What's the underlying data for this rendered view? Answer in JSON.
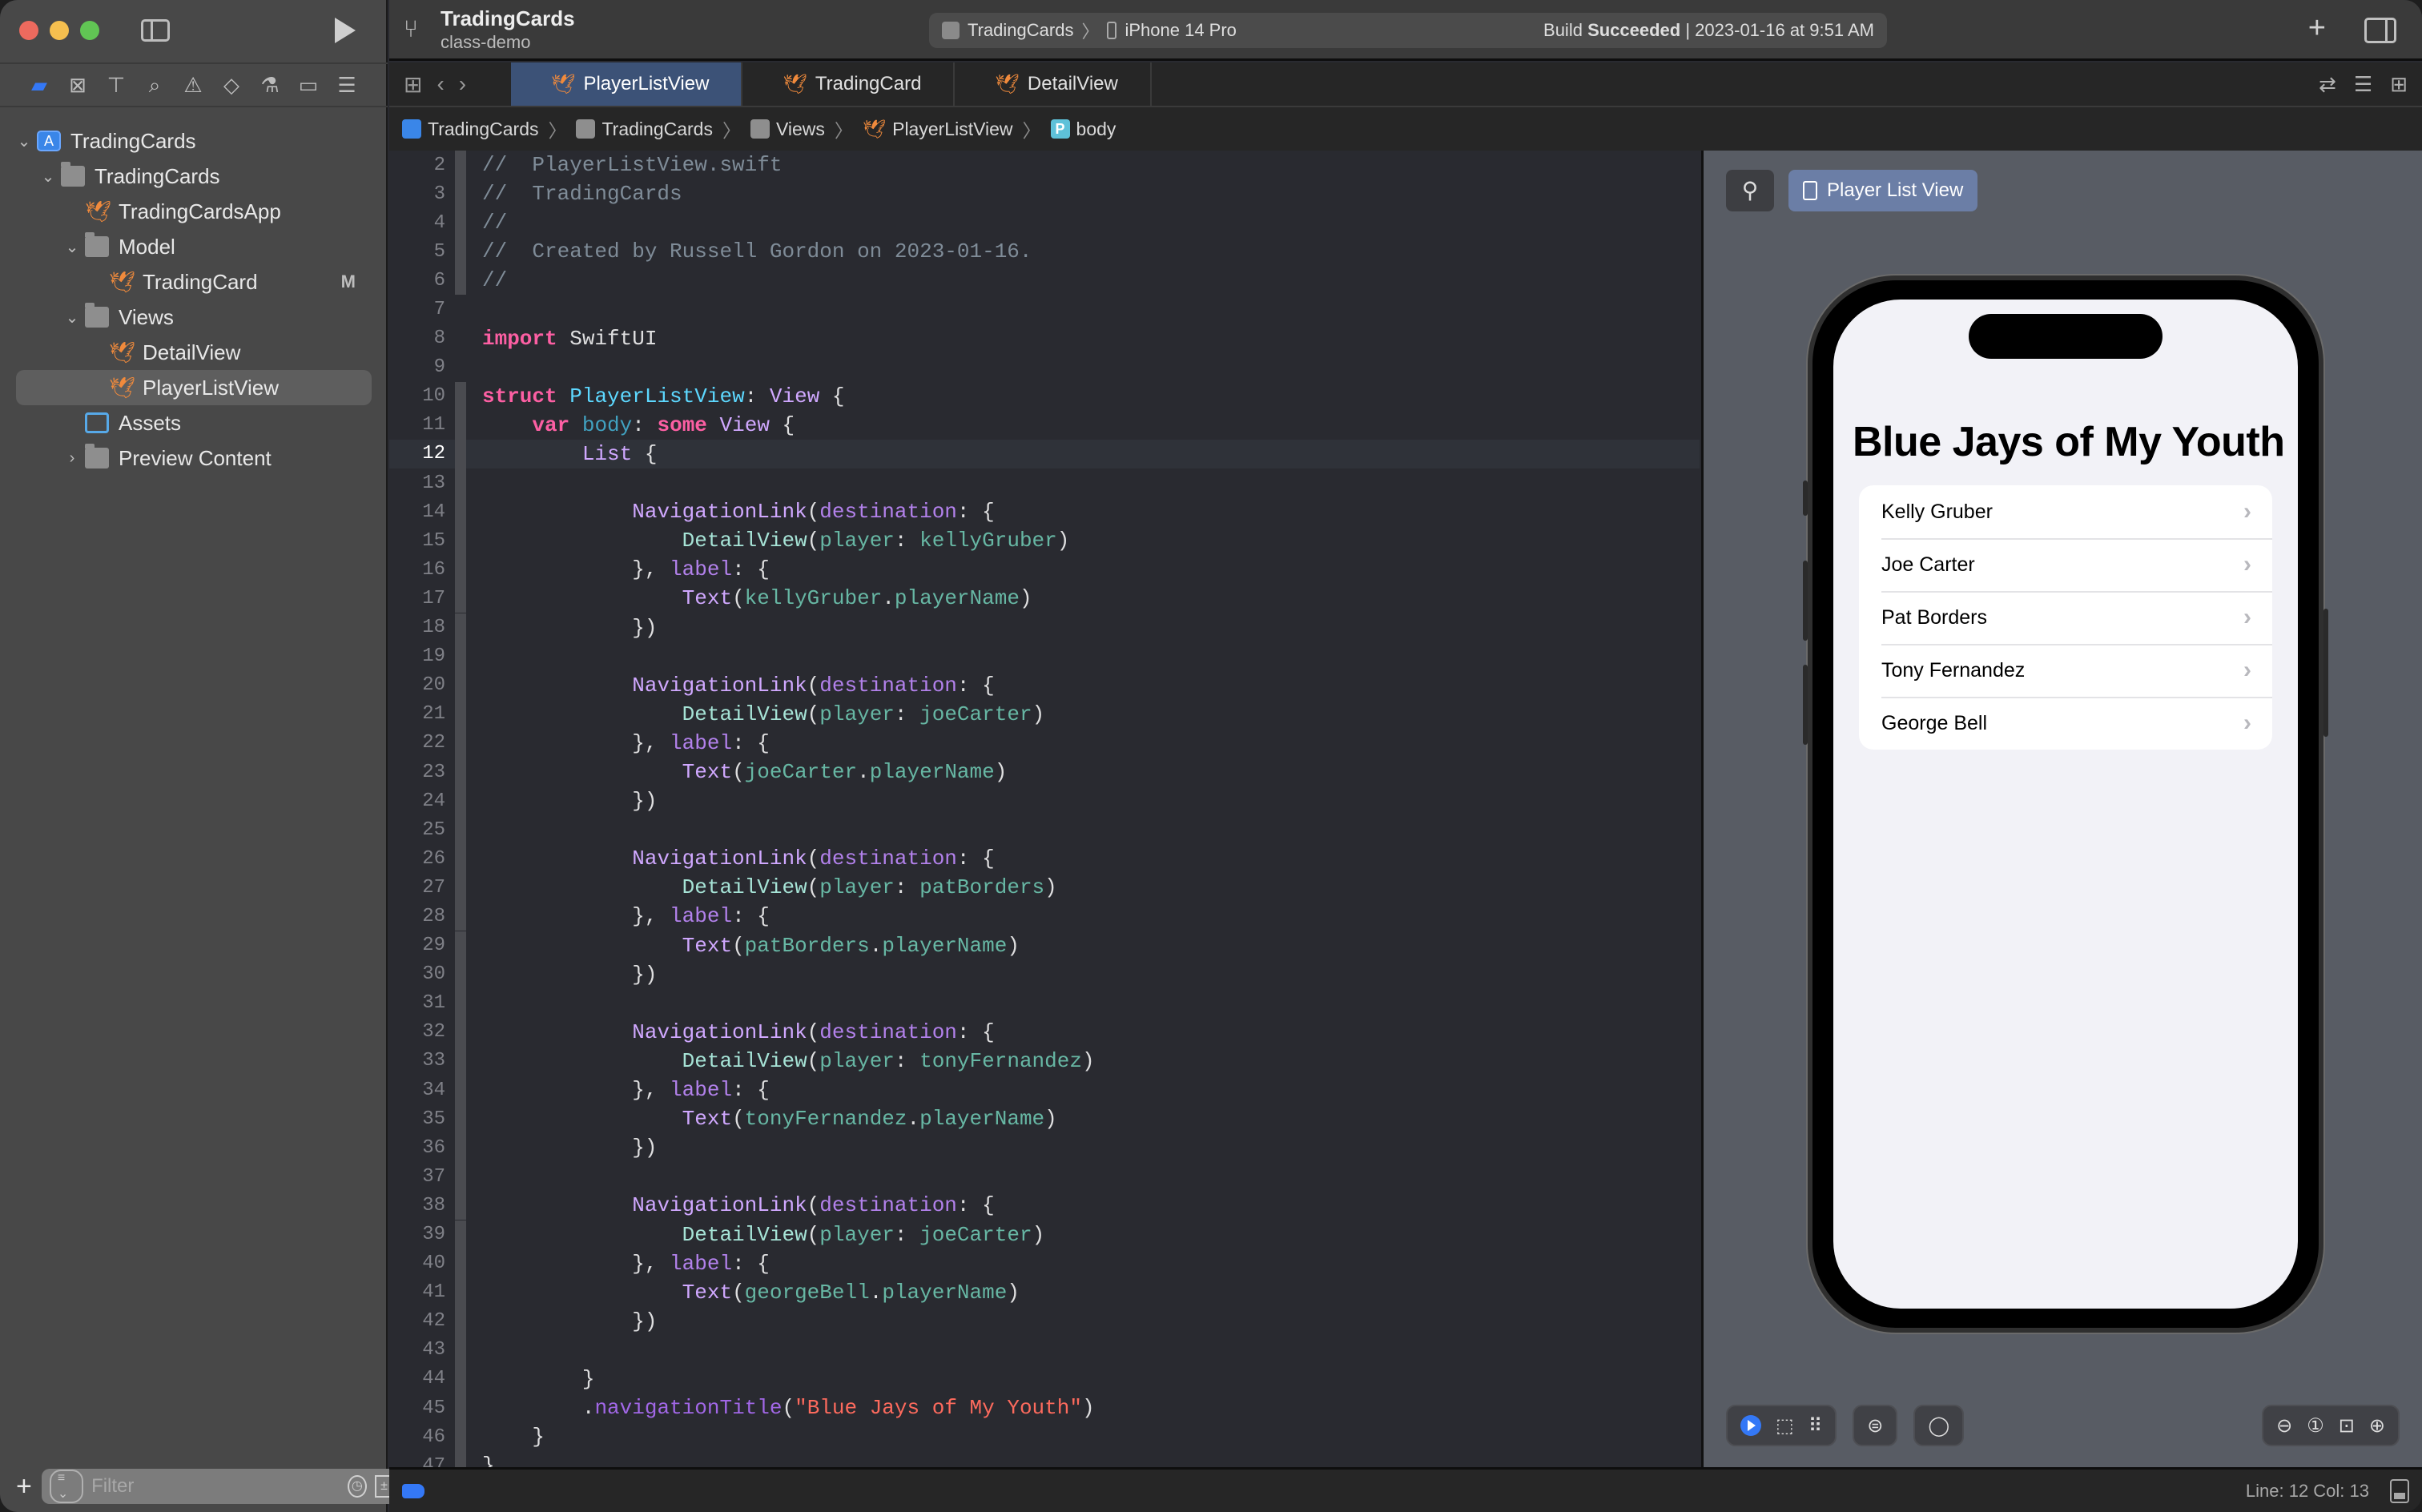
{
  "window": {
    "project_title": "TradingCards",
    "branch": "class-demo"
  },
  "toolbar": {
    "scheme_name": "TradingCards",
    "destination": "iPhone 14 Pro",
    "status_prefix": "Build",
    "status_bold": "Succeeded",
    "status_suffix": " | 2023-01-16 at 9:51 AM"
  },
  "navigator": {
    "tabs": [
      {
        "icon": "folder-icon",
        "glyph": "▰"
      },
      {
        "icon": "source-control-icon",
        "glyph": "⊠"
      },
      {
        "icon": "symbol-navigator-icon",
        "glyph": "⊤"
      },
      {
        "icon": "find-icon",
        "glyph": "⌕"
      },
      {
        "icon": "issue-icon",
        "glyph": "⚠"
      },
      {
        "icon": "test-icon",
        "glyph": "◇"
      },
      {
        "icon": "debug-icon",
        "glyph": "⚗"
      },
      {
        "icon": "breakpoint-icon",
        "glyph": "▭"
      },
      {
        "icon": "report-icon",
        "glyph": "☰"
      }
    ],
    "tree": [
      {
        "label": "TradingCards",
        "type": "project",
        "depth": 0,
        "expanded": true
      },
      {
        "label": "TradingCards",
        "type": "folder",
        "depth": 1,
        "expanded": true
      },
      {
        "label": "TradingCardsApp",
        "type": "swift",
        "depth": 2
      },
      {
        "label": "Model",
        "type": "folder",
        "depth": 2,
        "expanded": true
      },
      {
        "label": "TradingCard",
        "type": "swift",
        "depth": 3,
        "badge": "M"
      },
      {
        "label": "Views",
        "type": "folder",
        "depth": 2,
        "expanded": true
      },
      {
        "label": "DetailView",
        "type": "swift",
        "depth": 3
      },
      {
        "label": "PlayerListView",
        "type": "swift",
        "depth": 3,
        "selected": true
      },
      {
        "label": "Assets",
        "type": "assets",
        "depth": 2
      },
      {
        "label": "Preview Content",
        "type": "folder",
        "depth": 2,
        "expanded": false
      }
    ],
    "filter_placeholder": "Filter"
  },
  "tabs": [
    {
      "label": "PlayerListView",
      "active": true
    },
    {
      "label": "TradingCard",
      "active": false
    },
    {
      "label": "DetailView",
      "active": false
    }
  ],
  "breadcrumb": {
    "items": [
      "TradingCards",
      "TradingCards",
      "Views",
      "PlayerListView",
      "body"
    ]
  },
  "editor": {
    "current_line": 12,
    "lines": [
      {
        "n": 2,
        "t": [
          [
            "cm",
            "//  PlayerListView.swift"
          ]
        ]
      },
      {
        "n": 3,
        "t": [
          [
            "cm",
            "//  TradingCards"
          ]
        ]
      },
      {
        "n": 4,
        "t": [
          [
            "cm",
            "//"
          ]
        ]
      },
      {
        "n": 5,
        "t": [
          [
            "cm",
            "//  Created by Russell Gordon on 2023-01-16."
          ]
        ]
      },
      {
        "n": 6,
        "t": [
          [
            "cm",
            "//"
          ]
        ]
      },
      {
        "n": 7,
        "t": []
      },
      {
        "n": 8,
        "t": [
          [
            "kw",
            "import"
          ],
          [
            "pl",
            " SwiftUI"
          ]
        ]
      },
      {
        "n": 9,
        "t": []
      },
      {
        "n": 10,
        "t": [
          [
            "kw",
            "struct"
          ],
          [
            "pl",
            " "
          ],
          [
            "ty",
            "PlayerListView"
          ],
          [
            "pl",
            ": "
          ],
          [
            "tp",
            "View"
          ],
          [
            "pl",
            " {"
          ]
        ]
      },
      {
        "n": 11,
        "t": [
          [
            "pl",
            "    "
          ],
          [
            "kw",
            "var"
          ],
          [
            "pl",
            " "
          ],
          [
            "bl",
            "body"
          ],
          [
            "pl",
            ": "
          ],
          [
            "kw",
            "some"
          ],
          [
            "pl",
            " "
          ],
          [
            "tp",
            "View"
          ],
          [
            "pl",
            " {"
          ]
        ]
      },
      {
        "n": 12,
        "t": [
          [
            "pl",
            "        "
          ],
          [
            "tp",
            "List"
          ],
          [
            "pl",
            " {"
          ]
        ]
      },
      {
        "n": 13,
        "t": []
      },
      {
        "n": 14,
        "t": [
          [
            "pl",
            "            "
          ],
          [
            "tp",
            "NavigationLink"
          ],
          [
            "pl",
            "("
          ],
          [
            "at",
            "destination"
          ],
          [
            "pl",
            ": {"
          ]
        ]
      },
      {
        "n": 15,
        "t": [
          [
            "pl",
            "                "
          ],
          [
            "pr",
            "DetailView"
          ],
          [
            "pl",
            "("
          ],
          [
            "vr",
            "player"
          ],
          [
            "pl",
            ": "
          ],
          [
            "vr",
            "kellyGruber"
          ],
          [
            "pl",
            ")"
          ]
        ]
      },
      {
        "n": 16,
        "t": [
          [
            "pl",
            "            }, "
          ],
          [
            "at",
            "label"
          ],
          [
            "pl",
            ": {"
          ]
        ]
      },
      {
        "n": 17,
        "t": [
          [
            "pl",
            "                "
          ],
          [
            "tp",
            "Text"
          ],
          [
            "pl",
            "("
          ],
          [
            "vr",
            "kellyGruber"
          ],
          [
            "pl",
            "."
          ],
          [
            "vr",
            "playerName"
          ],
          [
            "pl",
            ")"
          ]
        ]
      },
      {
        "n": 18,
        "t": [
          [
            "pl",
            "            })"
          ]
        ]
      },
      {
        "n": 19,
        "t": []
      },
      {
        "n": 20,
        "t": [
          [
            "pl",
            "            "
          ],
          [
            "tp",
            "NavigationLink"
          ],
          [
            "pl",
            "("
          ],
          [
            "at",
            "destination"
          ],
          [
            "pl",
            ": {"
          ]
        ]
      },
      {
        "n": 21,
        "t": [
          [
            "pl",
            "                "
          ],
          [
            "pr",
            "DetailView"
          ],
          [
            "pl",
            "("
          ],
          [
            "vr",
            "player"
          ],
          [
            "pl",
            ": "
          ],
          [
            "vr",
            "joeCarter"
          ],
          [
            "pl",
            ")"
          ]
        ]
      },
      {
        "n": 22,
        "t": [
          [
            "pl",
            "            }, "
          ],
          [
            "at",
            "label"
          ],
          [
            "pl",
            ": {"
          ]
        ]
      },
      {
        "n": 23,
        "t": [
          [
            "pl",
            "                "
          ],
          [
            "tp",
            "Text"
          ],
          [
            "pl",
            "("
          ],
          [
            "vr",
            "joeCarter"
          ],
          [
            "pl",
            "."
          ],
          [
            "vr",
            "playerName"
          ],
          [
            "pl",
            ")"
          ]
        ]
      },
      {
        "n": 24,
        "t": [
          [
            "pl",
            "            })"
          ]
        ]
      },
      {
        "n": 25,
        "t": []
      },
      {
        "n": 26,
        "t": [
          [
            "pl",
            "            "
          ],
          [
            "tp",
            "NavigationLink"
          ],
          [
            "pl",
            "("
          ],
          [
            "at",
            "destination"
          ],
          [
            "pl",
            ": {"
          ]
        ]
      },
      {
        "n": 27,
        "t": [
          [
            "pl",
            "                "
          ],
          [
            "pr",
            "DetailView"
          ],
          [
            "pl",
            "("
          ],
          [
            "vr",
            "player"
          ],
          [
            "pl",
            ": "
          ],
          [
            "vr",
            "patBorders"
          ],
          [
            "pl",
            ")"
          ]
        ]
      },
      {
        "n": 28,
        "t": [
          [
            "pl",
            "            }, "
          ],
          [
            "at",
            "label"
          ],
          [
            "pl",
            ": {"
          ]
        ]
      },
      {
        "n": 29,
        "t": [
          [
            "pl",
            "                "
          ],
          [
            "tp",
            "Text"
          ],
          [
            "pl",
            "("
          ],
          [
            "vr",
            "patBorders"
          ],
          [
            "pl",
            "."
          ],
          [
            "vr",
            "playerName"
          ],
          [
            "pl",
            ")"
          ]
        ]
      },
      {
        "n": 30,
        "t": [
          [
            "pl",
            "            })"
          ]
        ]
      },
      {
        "n": 31,
        "t": []
      },
      {
        "n": 32,
        "t": [
          [
            "pl",
            "            "
          ],
          [
            "tp",
            "NavigationLink"
          ],
          [
            "pl",
            "("
          ],
          [
            "at",
            "destination"
          ],
          [
            "pl",
            ": {"
          ]
        ]
      },
      {
        "n": 33,
        "t": [
          [
            "pl",
            "                "
          ],
          [
            "pr",
            "DetailView"
          ],
          [
            "pl",
            "("
          ],
          [
            "vr",
            "player"
          ],
          [
            "pl",
            ": "
          ],
          [
            "vr",
            "tonyFernandez"
          ],
          [
            "pl",
            ")"
          ]
        ]
      },
      {
        "n": 34,
        "t": [
          [
            "pl",
            "            }, "
          ],
          [
            "at",
            "label"
          ],
          [
            "pl",
            ": {"
          ]
        ]
      },
      {
        "n": 35,
        "t": [
          [
            "pl",
            "                "
          ],
          [
            "tp",
            "Text"
          ],
          [
            "pl",
            "("
          ],
          [
            "vr",
            "tonyFernandez"
          ],
          [
            "pl",
            "."
          ],
          [
            "vr",
            "playerName"
          ],
          [
            "pl",
            ")"
          ]
        ]
      },
      {
        "n": 36,
        "t": [
          [
            "pl",
            "            })"
          ]
        ]
      },
      {
        "n": 37,
        "t": []
      },
      {
        "n": 38,
        "t": [
          [
            "pl",
            "            "
          ],
          [
            "tp",
            "NavigationLink"
          ],
          [
            "pl",
            "("
          ],
          [
            "at",
            "destination"
          ],
          [
            "pl",
            ": {"
          ]
        ]
      },
      {
        "n": 39,
        "t": [
          [
            "pl",
            "                "
          ],
          [
            "pr",
            "DetailView"
          ],
          [
            "pl",
            "("
          ],
          [
            "vr",
            "player"
          ],
          [
            "pl",
            ": "
          ],
          [
            "vr",
            "joeCarter"
          ],
          [
            "pl",
            ")"
          ]
        ]
      },
      {
        "n": 40,
        "t": [
          [
            "pl",
            "            }, "
          ],
          [
            "at",
            "label"
          ],
          [
            "pl",
            ": {"
          ]
        ]
      },
      {
        "n": 41,
        "t": [
          [
            "pl",
            "                "
          ],
          [
            "tp",
            "Text"
          ],
          [
            "pl",
            "("
          ],
          [
            "vr",
            "georgeBell"
          ],
          [
            "pl",
            "."
          ],
          [
            "vr",
            "playerName"
          ],
          [
            "pl",
            ")"
          ]
        ]
      },
      {
        "n": 42,
        "t": [
          [
            "pl",
            "            })"
          ]
        ]
      },
      {
        "n": 43,
        "t": []
      },
      {
        "n": 44,
        "t": [
          [
            "pl",
            "        }"
          ]
        ]
      },
      {
        "n": 45,
        "t": [
          [
            "pl",
            "        ."
          ],
          [
            "fn",
            "navigationTitle"
          ],
          [
            "pl",
            "("
          ],
          [
            "st",
            "\"Blue Jays of My Youth\""
          ],
          [
            "pl",
            ")"
          ]
        ]
      },
      {
        "n": 46,
        "t": [
          [
            "pl",
            "    }"
          ]
        ]
      },
      {
        "n": 47,
        "t": [
          [
            "pl",
            "}"
          ]
        ]
      }
    ]
  },
  "canvas": {
    "preview_label": "Player List View",
    "nav_title": "Blue Jays of My Youth",
    "players": [
      "Kelly Gruber",
      "Joe Carter",
      "Pat Borders",
      "Tony Fernandez",
      "George Bell"
    ]
  },
  "status": {
    "position": "Line: 12  Col: 13"
  },
  "colors": {
    "accent": "#3478f6",
    "active_tab": "#3c5277",
    "preview_button": "#6b7ea6",
    "swift_orange": "#f08a3c"
  }
}
